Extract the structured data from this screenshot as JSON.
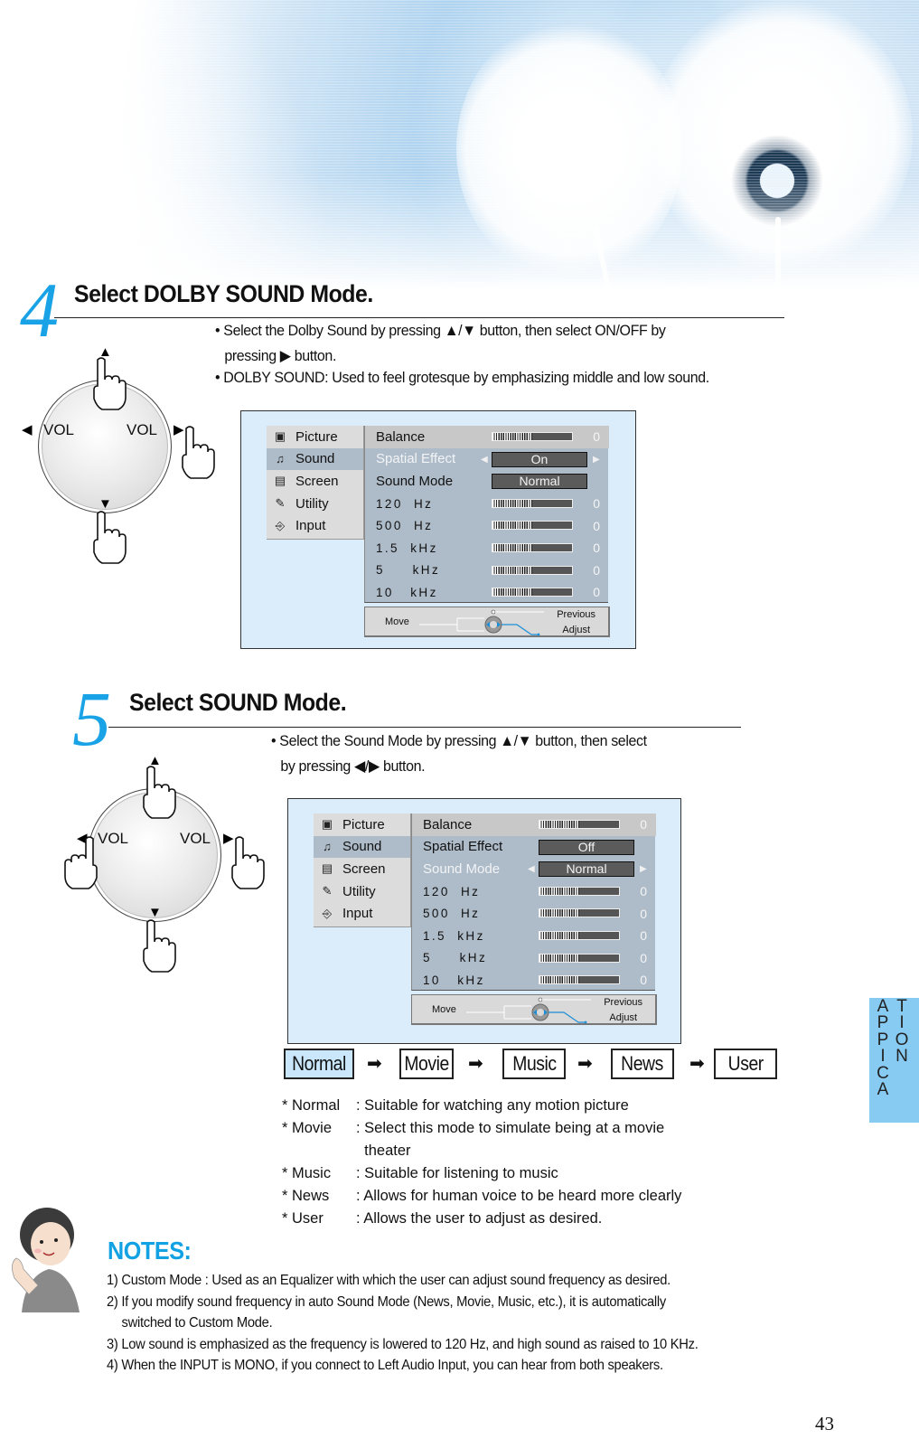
{
  "step4": {
    "number": "4",
    "title": "Select DOLBY SOUND Mode.",
    "bullets": [
      "• Select the Dolby Sound by pressing  ▲/▼  button, then select ON/OFF by",
      "pressing ▶ button.",
      "• DOLBY SOUND: Used to feel grotesque by emphasizing middle and low sound."
    ],
    "dial": {
      "left_label": "VOL",
      "right_label": "VOL"
    },
    "osd": {
      "menu": [
        {
          "label": "Picture",
          "icon": "picture-icon",
          "glyph": "▣"
        },
        {
          "label": "Sound",
          "icon": "sound-icon",
          "glyph": "♫",
          "active": true
        },
        {
          "label": "Screen",
          "icon": "screen-icon",
          "glyph": "▤"
        },
        {
          "label": "Utility",
          "icon": "utility-icon",
          "glyph": "✎"
        },
        {
          "label": "Input",
          "icon": "input-icon",
          "glyph": "⎆"
        }
      ],
      "rows": [
        {
          "label": "Balance",
          "type": "bar",
          "value": "0",
          "level": 0.5
        },
        {
          "label": "Spatial Effect",
          "type": "option",
          "value": "On",
          "highlighted": true
        },
        {
          "label": "Sound Mode",
          "type": "option",
          "value": "Normal"
        },
        {
          "label": "120  Hz",
          "type": "bar",
          "value": "0",
          "level": 0.5
        },
        {
          "label": "500  Hz",
          "type": "bar",
          "value": "0",
          "level": 0.5
        },
        {
          "label": "1.5  kHz",
          "type": "bar",
          "value": "0",
          "level": 0.5
        },
        {
          "label": "5     kHz",
          "type": "bar",
          "value": "0",
          "level": 0.5
        },
        {
          "label": "10   kHz",
          "type": "bar",
          "value": "0",
          "level": 0.5
        }
      ],
      "footer": {
        "move": "Move",
        "previous": "Previous",
        "adjust": "Adjust"
      }
    }
  },
  "step5": {
    "number": "5",
    "title": "Select SOUND Mode.",
    "bullets": [
      "• Select the Sound Mode by pressing  ▲/▼  button, then select",
      "by pressing ◀/▶ button."
    ],
    "dial": {
      "left_label": "VOL",
      "right_label": "VOL"
    },
    "osd": {
      "menu": [
        {
          "label": "Picture",
          "icon": "picture-icon",
          "glyph": "▣"
        },
        {
          "label": "Sound",
          "icon": "sound-icon",
          "glyph": "♫",
          "active": true
        },
        {
          "label": "Screen",
          "icon": "screen-icon",
          "glyph": "▤"
        },
        {
          "label": "Utility",
          "icon": "utility-icon",
          "glyph": "✎"
        },
        {
          "label": "Input",
          "icon": "input-icon",
          "glyph": "⎆"
        }
      ],
      "rows": [
        {
          "label": "Balance",
          "type": "bar",
          "value": "0",
          "level": 0.5
        },
        {
          "label": "Spatial Effect",
          "type": "option",
          "value": "Off"
        },
        {
          "label": "Sound Mode",
          "type": "option",
          "value": "Normal",
          "highlighted": true
        },
        {
          "label": "120  Hz",
          "type": "bar",
          "value": "0",
          "level": 0.5
        },
        {
          "label": "500  Hz",
          "type": "bar",
          "value": "0",
          "level": 0.5
        },
        {
          "label": "1.5  kHz",
          "type": "bar",
          "value": "0",
          "level": 0.5
        },
        {
          "label": "5     kHz",
          "type": "bar",
          "value": "0",
          "level": 0.5
        },
        {
          "label": "10   kHz",
          "type": "bar",
          "value": "0",
          "level": 0.5
        }
      ],
      "footer": {
        "move": "Move",
        "previous": "Previous",
        "adjust": "Adjust"
      }
    },
    "mode_chain": {
      "modes": [
        "Normal",
        "Movie",
        "Music",
        "News",
        "User"
      ],
      "selected": "Normal",
      "arrow": "➡"
    },
    "definitions": [
      {
        "term": "* Normal",
        "desc": ": Suitable for watching any motion picture"
      },
      {
        "term": "* Movie",
        "desc": ": Select this mode to simulate being at a movie"
      },
      {
        "term": "",
        "desc": "  theater"
      },
      {
        "term": "* Music",
        "desc": ": Suitable for listening to music"
      },
      {
        "term": "* News",
        "desc": ": Allows for human voice to be heard more clearly"
      },
      {
        "term": "* User",
        "desc": ": Allows the user to adjust as desired."
      }
    ]
  },
  "notes": {
    "title": "NOTES:",
    "items": [
      {
        "text": "1) Custom Mode : Used as an Equalizer with which the user can adjust sound frequency as desired."
      },
      {
        "text": "2) If you modify sound frequency in auto Sound Mode (News, Movie, Music, etc.), it is automatically"
      },
      {
        "text": "switched to Custom Mode.",
        "indent": true
      },
      {
        "text": "3) Low sound is emphasized as the frequency is lowered to 120 Hz, and high sound as raised to 10 KHz."
      },
      {
        "text": "4) When the INPUT is MONO, if you connect to Left Audio Input, you can hear from both speakers."
      }
    ]
  },
  "side_tab": {
    "col1": [
      "A",
      "P",
      "P",
      "I",
      "C",
      "A"
    ],
    "col2": [
      "T",
      "I",
      "O",
      "N"
    ]
  },
  "page_number": "43",
  "colors": {
    "accent_blue": "#19a3e6",
    "notes_blue": "#12a2e4",
    "side_tab": "#87cbf3",
    "osd_frame_bg": "#dbedfb",
    "osd_panel": "#aebbc8",
    "selected_mode_bg": "#c9e6fa"
  }
}
